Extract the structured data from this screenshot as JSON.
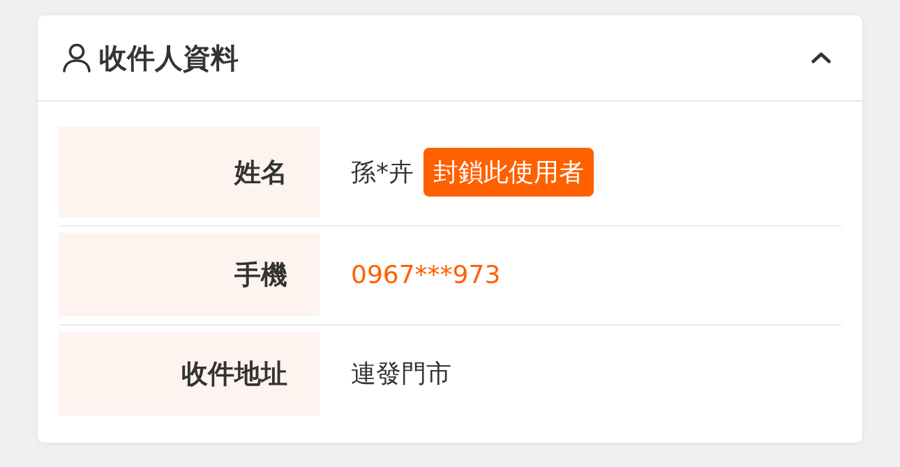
{
  "section": {
    "title": "收件人資料",
    "expanded": true
  },
  "fields": [
    {
      "label": "姓名",
      "kind": "text",
      "value": "孫*卉",
      "badge": "封鎖此使用者"
    },
    {
      "label": "手機",
      "kind": "phone",
      "value": "0967***973"
    },
    {
      "label": "收件地址",
      "kind": "text",
      "value": "連發門市"
    }
  ]
}
